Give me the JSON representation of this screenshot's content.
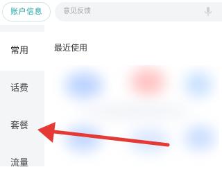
{
  "header": {
    "account_button": "账户信息",
    "search_placeholder": "意见反馈",
    "mic_icon": "mic-icon"
  },
  "sidebar": {
    "items": [
      {
        "label": "常用",
        "active": true
      },
      {
        "label": "话费",
        "active": false
      },
      {
        "label": "套餐",
        "active": false
      },
      {
        "label": "流量",
        "active": false
      }
    ]
  },
  "main": {
    "section_title": "最近使用"
  },
  "colors": {
    "accent": "#1aa3a3",
    "arrow": "#e53935"
  }
}
